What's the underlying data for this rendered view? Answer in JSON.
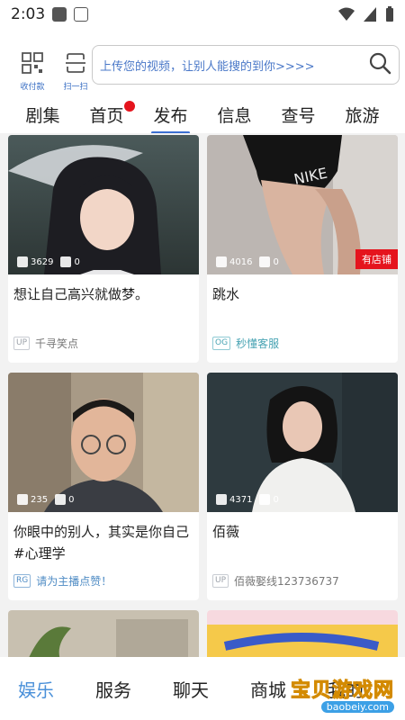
{
  "status": {
    "time": "2:03"
  },
  "header": {
    "buttons": [
      {
        "label": "收付款",
        "icon": "qr-grid-icon"
      },
      {
        "label": "扫一扫",
        "icon": "scan-icon"
      }
    ],
    "search": {
      "text": "上传您的视频，让别人能搜的到你>>>>",
      "icon": "search-icon"
    }
  },
  "tabs": [
    {
      "label": "剧集"
    },
    {
      "label": "首页",
      "badge": "red-dot"
    },
    {
      "label": "发布",
      "active": true
    },
    {
      "label": "信息"
    },
    {
      "label": "查号"
    },
    {
      "label": "旅游"
    }
  ],
  "feed": {
    "cards": [
      {
        "title": "想让自己高兴就做梦。",
        "likes": "3629",
        "comments": "0",
        "tag": "UP",
        "author": "千寻笑点",
        "shop_badge": ""
      },
      {
        "title": "跳水",
        "likes": "4016",
        "comments": "0",
        "tag": "OG",
        "author": "秒懂客服",
        "shop_badge": "有店铺"
      },
      {
        "title": "你眼中的别人，其实是你自己#心理学",
        "likes": "235",
        "comments": "0",
        "tag": "RG",
        "author": "请为主播点赞！",
        "shop_badge": ""
      },
      {
        "title": "佰薇",
        "likes": "4371",
        "comments": "0",
        "tag": "UP",
        "author": "佰薇娶线123736737",
        "shop_badge": ""
      }
    ]
  },
  "bottom_nav": [
    {
      "label": "娱乐",
      "active": true
    },
    {
      "label": "服务"
    },
    {
      "label": "聊天"
    },
    {
      "label": "商城"
    },
    {
      "label": "我的"
    }
  ],
  "watermark": {
    "top": "宝贝游戏网",
    "bottom": "baobeiy.com"
  },
  "colors": {
    "accent": "#3b6fd1",
    "badge_red": "#e5141d",
    "search_text": "#4a78c8",
    "nav_active": "#4a90d9"
  }
}
